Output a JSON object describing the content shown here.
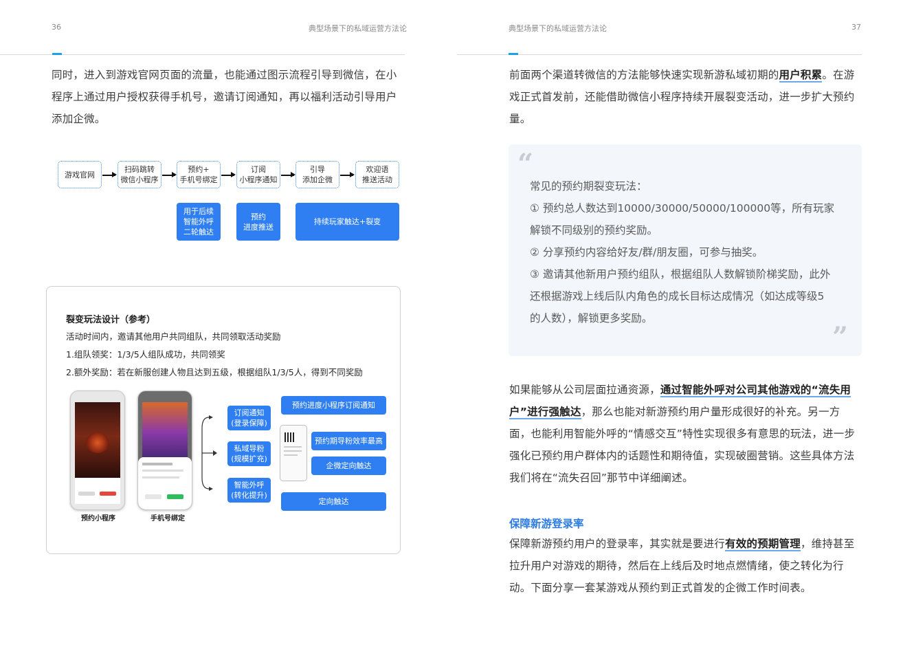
{
  "left_page": {
    "page_number": "36",
    "running_title": "典型场景下的私域运营方法论",
    "intro_lines": [
      "同时，进入到游戏官网页面的流量，也能通过图示流程引导到微信，在小",
      "程序上通过用户授权获得手机号，邀请订阅通知，再以福利活动引导用户",
      "添加企微。"
    ],
    "flow_steps": [
      "游戏官网",
      "扫码跳转\n微信小程序",
      "预约+\n手机号绑定",
      "订阅\n小程序通知",
      "引导\n添加企微",
      "欢迎语\n推送活动"
    ],
    "flow_actions": [
      "用于后续\n智能外呼\n二轮触达",
      "预约\n进度推送",
      "持续玩家触达+裂变"
    ],
    "card": {
      "title": "裂变玩法设计（参考）",
      "lines": [
        "活动时间内，邀请其他用户共同组队，共同领取活动奖励",
        "1.组队领奖：1/3/5人组队成功，共同领奖",
        "2.额外奖励：若在新服创建人物且达到五级，根据组队1/3/5人，得到不同奖励"
      ],
      "phone_labels": [
        "预约小程序",
        "手机号绑定"
      ],
      "channels": [
        "订阅通知\n(登录保障)",
        "私域导粉\n(规模扩充)",
        "智能外呼\n(转化提升)"
      ],
      "results": [
        "预约进度小程序订阅通知",
        "预约期导粉效率最高",
        "企微定向触达",
        "定向触达"
      ]
    }
  },
  "right_page": {
    "page_number": "37",
    "running_title": "典型场景下的私域运营方法论",
    "p1": {
      "l1_pre": "前面两个渠道转微信的方法能够快速实现新游私域初期的",
      "l1_bold": "用户积累",
      "l1_post": "。在游",
      "l2": "戏正式首发前，还能借助微信小程序持续开展裂变活动，进一步扩大预约",
      "l3": "量。"
    },
    "quote": {
      "open_mark": "“",
      "close_mark": "”",
      "lines": [
        "常见的预约期裂变玩法：",
        "①  预约总人数达到10000/30000/50000/100000等，所有玩家",
        "解锁不同级别的预约奖励。",
        "② 分享预约内容给好友/群/朋友圈，可参与抽奖。",
        "③ 邀请其他新用户预约组队，根据组队人数解锁阶梯奖励，此外",
        "还根据游戏上线后队内角色的成长目标达成情况（如达成等级5",
        "的人数），解锁更多奖励。"
      ]
    },
    "p2": {
      "l1_pre": "如果能够从公司层面拉通资源，",
      "l1_bold": "通过智能外呼对公司其他游戏的“流失用",
      "l2_bold": "户”进行强触达",
      "l2_post": "，那么也能对新游预约用户量形成很好的补充。另一方",
      "l3": "面，也能利用智能外呼的“情感交互”特性实现很多有意思的玩法，进一步",
      "l4": "强化已预约用户群体内的话题性和期待值，实现破圈营销。这些具体方法",
      "l5": "我们将在“流失召回”那节中详细阐述。"
    },
    "section_title": "保障新游登录率",
    "p3": {
      "l1_pre": "保障新游预约用户的登录率，其实就是要进行",
      "l1_bold": "有效的预期管理",
      "l1_post": "，维持甚至",
      "l2": "拉升用户对游戏的期待，然后在上线后及时地点燃情绪，使之转化为行",
      "l3": "动。下面分享一套某游戏从预约到正式首发的企微工作时间表。"
    }
  },
  "colors": {
    "accent": "#1aa3e8",
    "primary_blue": "#2f7ff2",
    "section_title": "#2b7be0",
    "quote_bg": "#f3f6fb"
  }
}
